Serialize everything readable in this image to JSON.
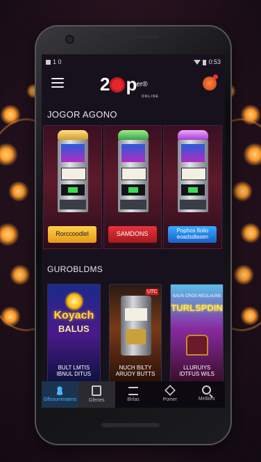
{
  "status_bar": {
    "left": "1 0",
    "time": "0:53"
  },
  "header": {
    "brand_prefix": "2",
    "brand_mid": "p",
    "brand_suffix": "er",
    "brand_mark": "®",
    "tagline": "ONLINE"
  },
  "sections": {
    "featured_title": "JOGOR AGONO",
    "games_title": "GUROBLDMS"
  },
  "machines": [
    {
      "button": "Rorccoodlel",
      "theme": "yellow"
    },
    {
      "button": "SAMDONS",
      "theme": "red"
    },
    {
      "button": "Pophos flolio eoadsdlasen",
      "theme": "blue"
    }
  ],
  "games": [
    {
      "title": "Koyach",
      "subtitle": "BALUS",
      "caption": "BULT LMTIS\nIBNUL DITUS"
    },
    {
      "badge": "UTC",
      "caption": "NUCH BILTY\nARUOY BUTTS"
    },
    {
      "top": "SAUS CROS REOLAUNS",
      "title": "TURLSPDING",
      "caption": "LLURUIYS\nIDTFUS WILS"
    }
  ],
  "nav": [
    {
      "label": "Gflnsurnmaens",
      "icon": "user-icon",
      "state": "active"
    },
    {
      "label": "Gfenes",
      "icon": "slot-icon",
      "state": "selected"
    },
    {
      "label": "Blrlas",
      "icon": "list-icon",
      "state": "normal"
    },
    {
      "label": "Pomer",
      "icon": "cube-icon",
      "state": "normal"
    },
    {
      "label": "Melikes",
      "icon": "search-icon",
      "state": "normal"
    }
  ],
  "colors": {
    "accent_blue": "#4ab4ff",
    "brand_red": "#e8252a",
    "background": "#17111d"
  }
}
